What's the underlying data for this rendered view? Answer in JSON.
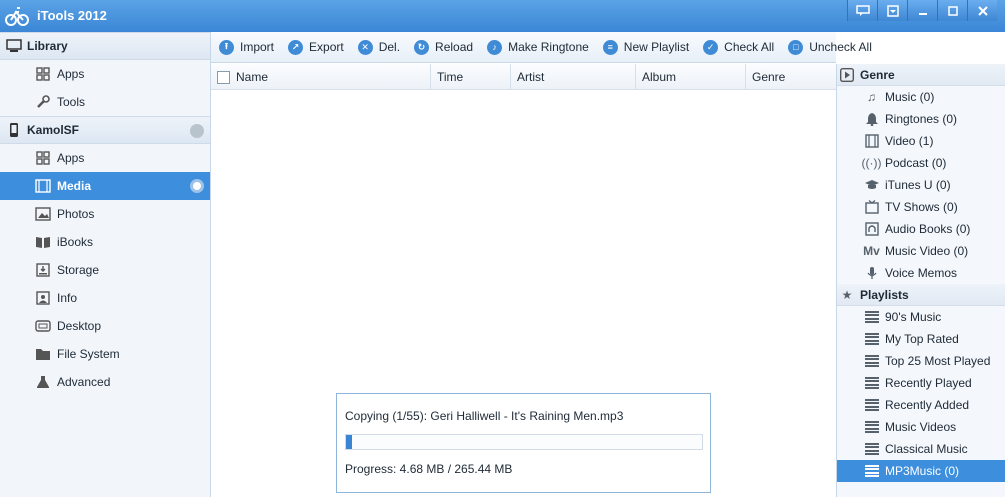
{
  "app": {
    "title": "iTools 2012"
  },
  "window_buttons": [
    "feedback-icon",
    "skin-icon",
    "minimize-icon",
    "maximize-icon",
    "close-icon"
  ],
  "sidebar": {
    "library": {
      "label": "Library",
      "items": [
        {
          "label": "Apps",
          "icon": "apps-icon"
        },
        {
          "label": "Tools",
          "icon": "wrench-icon"
        }
      ]
    },
    "device": {
      "label": "KamolSF",
      "items": [
        {
          "label": "Apps",
          "icon": "apps-icon"
        },
        {
          "label": "Media",
          "icon": "film-icon",
          "active": true
        },
        {
          "label": "Photos",
          "icon": "photo-icon"
        },
        {
          "label": "iBooks",
          "icon": "book-icon"
        },
        {
          "label": "Storage",
          "icon": "storage-icon"
        },
        {
          "label": "Info",
          "icon": "contact-card-icon"
        },
        {
          "label": "Desktop",
          "icon": "desktop-icon"
        },
        {
          "label": "File System",
          "icon": "folder-icon"
        },
        {
          "label": "Advanced",
          "icon": "flask-icon"
        }
      ]
    }
  },
  "toolbar": {
    "import": "Import",
    "export": "Export",
    "delete": "Del.",
    "reload": "Reload",
    "make_ringtone": "Make Ringtone",
    "new_playlist": "New Playlist",
    "check_all": "Check All",
    "uncheck_all": "Uncheck All"
  },
  "table": {
    "columns": [
      "Name",
      "Time",
      "Artist",
      "Album",
      "Genre"
    ],
    "rows": []
  },
  "progress": {
    "status": "Copying (1/55): Geri Halliwell - It's Raining Men.mp3",
    "fraction": 0.0176,
    "text": "Progress: 4.68 MB / 265.44 MB"
  },
  "right_panel": {
    "genre": {
      "label": "Genre",
      "items": [
        {
          "label": "Music (0)",
          "icon": "music-note-icon"
        },
        {
          "label": "Ringtones (0)",
          "icon": "bell-icon"
        },
        {
          "label": "Video (1)",
          "icon": "video-icon"
        },
        {
          "label": "Podcast (0)",
          "icon": "podcast-icon"
        },
        {
          "label": "iTunes U (0)",
          "icon": "graduation-cap-icon"
        },
        {
          "label": "TV Shows (0)",
          "icon": "tv-icon"
        },
        {
          "label": "Audio Books (0)",
          "icon": "audiobook-icon"
        },
        {
          "label": "Music Video (0)",
          "icon": "music-video-icon"
        },
        {
          "label": "Voice Memos",
          "icon": "microphone-icon"
        }
      ]
    },
    "playlists": {
      "label": "Playlists",
      "items": [
        {
          "label": "90's Music"
        },
        {
          "label": "My Top Rated"
        },
        {
          "label": "Top 25 Most Played"
        },
        {
          "label": "Recently Played"
        },
        {
          "label": "Recently Added"
        },
        {
          "label": "Music Videos"
        },
        {
          "label": "Classical Music"
        },
        {
          "label": "MP3Music (0)",
          "active": true
        }
      ]
    }
  },
  "colors": {
    "accent": "#3d8fde",
    "titlebar": "#3b86d6"
  }
}
